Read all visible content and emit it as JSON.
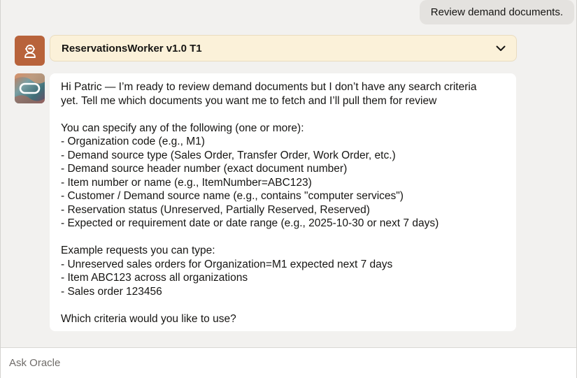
{
  "colors": {
    "page_bg": "#f2f1ef",
    "user_bubble_bg": "#e4e2df",
    "agent_avatar_bg": "#b8633b",
    "agent_header_bg": "#fbf1d9",
    "message_bg": "#ffffff"
  },
  "user_message": {
    "text": "Review demand documents."
  },
  "agent": {
    "name": "ReservationsWorker v1.0 T1",
    "avatar_icon": "robot-person-icon",
    "toggle_icon": "chevron-down-icon"
  },
  "assistant": {
    "avatar_icon": "oracle-logo-icon",
    "message": "Hi Patric — I’m ready to review demand documents but I don’t have any search criteria\nyet. Tell me which documents you want me to fetch and I’ll pull them for review\n\nYou can specify any of the following (one or more):\n- Organization code (e.g., M1)\n- Demand source type (Sales Order, Transfer Order, Work Order, etc.)\n- Demand source header number (exact document number)\n- Item number or name (e.g., ItemNumber=ABC123)\n- Customer / Demand source name (e.g., contains \"computer services\")\n- Reservation status (Unreserved, Partially Reserved, Reserved)\n- Expected or requirement date or date range (e.g., 2025-10-30 or next 7 days)\n\nExample requests you can type:\n- Unreserved sales orders for Organization=M1 expected next 7 days\n- Item ABC123 across all organizations\n- Sales order 123456\n\nWhich criteria would you like to use?"
  },
  "input": {
    "placeholder": "Ask Oracle",
    "value": ""
  }
}
